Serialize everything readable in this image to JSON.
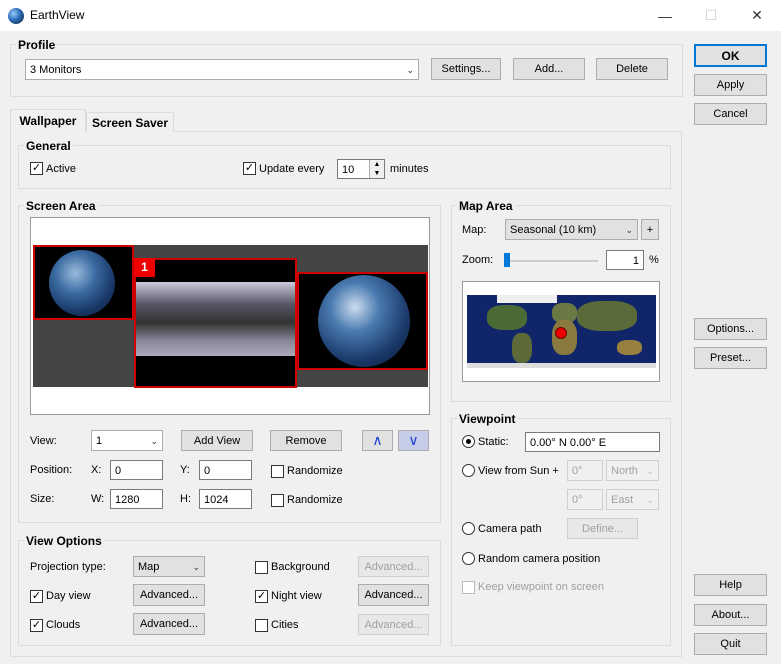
{
  "window": {
    "title": "EarthView",
    "minimize_icon": "minimize-icon",
    "maximize_icon": "maximize-icon",
    "close_icon": "close-icon"
  },
  "profile": {
    "title": "Profile",
    "selected": "3 Monitors",
    "settings_label": "Settings...",
    "add_label": "Add...",
    "delete_label": "Delete"
  },
  "side_buttons": {
    "ok": "OK",
    "apply": "Apply",
    "cancel": "Cancel",
    "options": "Options...",
    "preset": "Preset...",
    "help": "Help",
    "about": "About...",
    "quit": "Quit"
  },
  "tabs": [
    {
      "label": "Wallpaper",
      "active": true
    },
    {
      "label": "Screen Saver",
      "active": false
    }
  ],
  "general": {
    "title": "General",
    "active_label": "Active",
    "active_checked": true,
    "update_label": "Update every",
    "update_checked": true,
    "update_value": "10",
    "minutes_label": "minutes"
  },
  "screen_area": {
    "title": "Screen Area",
    "selected_monitor_badge": "1",
    "view_label": "View:",
    "view_value": "1",
    "add_view_label": "Add View",
    "remove_label": "Remove",
    "position_label": "Position:",
    "x_label": "X:",
    "x_value": "0",
    "y_label": "Y:",
    "y_value": "0",
    "size_label": "Size:",
    "w_label": "W:",
    "w_value": "1280",
    "h_label": "H:",
    "h_value": "1024",
    "randomize_label": "Randomize"
  },
  "map_area": {
    "title": "Map Area",
    "map_label": "Map:",
    "map_value": "Seasonal (10 km)",
    "plus_label": "+",
    "zoom_label": "Zoom:",
    "zoom_value": "1",
    "zoom_unit": "%",
    "zoom_level": 0.0
  },
  "viewpoint": {
    "title": "Viewpoint",
    "static_label": "Static:",
    "static_value": "0.00° N  0.00° E",
    "sun_label": "View from Sun +",
    "sun_deg1": "0°",
    "sun_dir1": "North",
    "sun_deg2": "0°",
    "sun_dir2": "East",
    "camera_path_label": "Camera path",
    "define_label": "Define...",
    "random_camera_label": "Random camera position",
    "keep_label": "Keep viewpoint on screen",
    "selected": "Static:"
  },
  "view_options": {
    "title": "View Options",
    "projection_label": "Projection type:",
    "projection_value": "Map",
    "day_view_label": "Day view",
    "clouds_label": "Clouds",
    "background_label": "Background",
    "night_view_label": "Night view",
    "cities_label": "Cities",
    "advanced_label": "Advanced..."
  }
}
